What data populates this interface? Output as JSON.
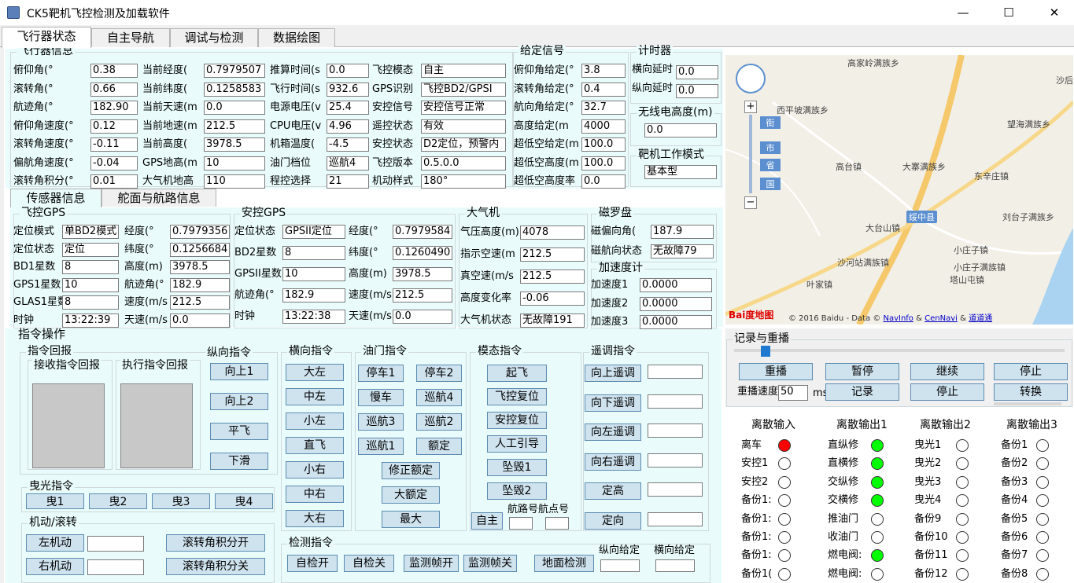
{
  "window": {
    "title": "CK5靶机飞控检测及加载软件",
    "minimize": "—",
    "maximize": "☐",
    "close": "✕"
  },
  "tabs": [
    "飞行器状态",
    "自主导航",
    "调试与检测",
    "数据绘图"
  ],
  "aircraft_info": {
    "title": "飞行器信息",
    "col1": [
      [
        "俯仰角(°",
        "0.38"
      ],
      [
        "滚转角(°",
        "0.66"
      ],
      [
        "航迹角(°",
        "182.90"
      ],
      [
        "俯仰角速度(°",
        "0.12"
      ],
      [
        "滚转角速度(°",
        "-0.11"
      ],
      [
        "偏航角速度(°",
        "-0.04"
      ],
      [
        "滚转角积分(°",
        "0.01"
      ]
    ],
    "col2": [
      [
        "当前经度(",
        "0.7979507"
      ],
      [
        "当前纬度(",
        "0.1258583"
      ],
      [
        "当前天速(m",
        "0.0"
      ],
      [
        "当前地速(m",
        "212.5"
      ],
      [
        "当前高度(",
        "3978.5"
      ],
      [
        "GPS地高(m",
        "10"
      ],
      [
        "大气机地高",
        "110"
      ]
    ],
    "col3": [
      [
        "推算时间(s",
        "0.0"
      ],
      [
        "飞行时间(s",
        "932.6"
      ],
      [
        "电源电压(v",
        "25.4"
      ],
      [
        "CPU电压(v",
        "4.96"
      ],
      [
        "机箱温度(",
        "-4.5"
      ],
      [
        "油门档位",
        "巡航4"
      ],
      [
        "程控选择",
        "21"
      ]
    ],
    "col4": [
      [
        "飞控模态",
        "自主"
      ],
      [
        "GPS识别",
        "飞控BD2/GPSI"
      ],
      [
        "安控信号",
        "安控信号正常"
      ],
      [
        "遥控状态",
        "有效"
      ],
      [
        "安控状态",
        "D2定位，预警内"
      ],
      [
        "飞控版本",
        "0.5.0.0"
      ],
      [
        "机动样式",
        "180°"
      ]
    ]
  },
  "given_signal": {
    "title": "给定信号",
    "rows": [
      [
        "俯仰角给定(°",
        "3.8"
      ],
      [
        "滚转角给定(°",
        "0.4"
      ],
      [
        "航向角给定(°",
        "32.7"
      ],
      [
        "高度给定(m",
        "4000"
      ],
      [
        "超低空给定(m",
        "100.0"
      ],
      [
        "超低空高度(m",
        "100.0"
      ],
      [
        "超低空高度率",
        "0.0"
      ]
    ]
  },
  "timer": {
    "title": "计时器",
    "rows": [
      [
        "横向延时",
        "0.0"
      ],
      [
        "纵向延时",
        "0.0"
      ]
    ]
  },
  "radio_alt": {
    "title": "无线电高度(m)",
    "value": "0.0"
  },
  "work_mode": {
    "title": "靶机工作模式",
    "value": "基本型"
  },
  "map": {
    "labels": [
      "高家岭满族乡",
      "西平坡满族乡",
      "望海满族乡",
      "高台镇",
      "大寨满族乡",
      "东辛庄镇",
      "绥中县",
      "刘台子满族乡",
      "大台山镇",
      "沙河站满族镇",
      "小庄子镇",
      "小庄子满族镇",
      "塔山屯镇",
      "叶家镇",
      "沙后"
    ],
    "zoom_levels": [
      "街",
      "市",
      "省",
      "国"
    ],
    "copyright": "© 2016 Baidu - Data ©",
    "navinfo": "NavInfo",
    "amp": "&",
    "cennavi": "CenNavi",
    "daodaotong": "道道通",
    "logo": "Bai度地图",
    "plus": "+",
    "minus": "−"
  },
  "subtabs": [
    "传感器信息",
    "舵面与航路信息"
  ],
  "fc_gps": {
    "title": "飞控GPS",
    "left": [
      [
        "定位模式",
        "单BD2模式"
      ],
      [
        "定位状态",
        "定位"
      ],
      [
        "BD1星数",
        "8"
      ],
      [
        "GPS1星数",
        "10"
      ],
      [
        "GLAS1星数",
        "8"
      ],
      [
        "时钟",
        "13:22:39"
      ]
    ],
    "right": [
      [
        "经度(°",
        "0.7979356"
      ],
      [
        "纬度(°",
        "0.1256684"
      ],
      [
        "高度(m)",
        "3978.5"
      ],
      [
        "航迹角(°",
        "182.9"
      ],
      [
        "速度(m/s",
        "212.5"
      ],
      [
        "天速(m/s",
        "0.0"
      ]
    ]
  },
  "sc_gps": {
    "title": "安控GPS",
    "left": [
      [
        "定位状态",
        "GPSII定位"
      ],
      [
        "BD2星数",
        "8"
      ],
      [
        "GPSII星数",
        "10"
      ],
      [
        "航迹角(°",
        "182.9"
      ],
      [
        "时钟",
        "13:22:38"
      ]
    ],
    "right": [
      [
        "经度(°",
        "0.7979584"
      ],
      [
        "纬度(°",
        "0.1260490"
      ],
      [
        "高度(m)",
        "3978.5"
      ],
      [
        "速度(m/s",
        "212.5"
      ],
      [
        "天速(m/s",
        "0.0"
      ]
    ]
  },
  "air_data": {
    "title": "大气机",
    "rows": [
      [
        "气压高度(m)",
        "4078"
      ],
      [
        "指示空速(m",
        "212.5"
      ],
      [
        "真空速(m/s",
        "212.5"
      ],
      [
        "高度变化率",
        "-0.06"
      ],
      [
        "大气机状态",
        "无故障191"
      ]
    ]
  },
  "compass": {
    "title": "磁罗盘",
    "rows": [
      [
        "磁偏向角(",
        "187.9"
      ],
      [
        "磁航向状态",
        "无故障79"
      ]
    ]
  },
  "accel": {
    "title": "加速度计",
    "rows": [
      [
        "加速度1",
        "0.0000"
      ],
      [
        "加速度2",
        "0.0000"
      ],
      [
        "加速度3",
        "0.0000"
      ]
    ]
  },
  "cmd": {
    "title": "指令操作",
    "echo": {
      "title": "指令回报",
      "recv": "接收指令回报",
      "exec": "执行指令回报"
    },
    "long": {
      "title": "纵向指令",
      "buttons": [
        "向上1",
        "向上2",
        "平飞",
        "下滑"
      ]
    },
    "lat": {
      "title": "横向指令",
      "buttons": [
        "大左",
        "中左",
        "小左",
        "直飞",
        "小右",
        "中右",
        "大右"
      ]
    },
    "throttle": {
      "title": "油门指令",
      "buttons": [
        "停车1",
        "停车2",
        "慢车",
        "巡航4",
        "巡航3",
        "巡航2",
        "巡航1",
        "额定",
        "修正额定",
        "大额定",
        "最大"
      ]
    },
    "mode": {
      "title": "模态指令",
      "buttons": [
        "起飞",
        "飞控复位",
        "安控复位",
        "人工引导",
        "坠毁1",
        "坠毁2",
        "自主"
      ],
      "route_label": "航路号航点号"
    },
    "remote": {
      "title": "遥调指令",
      "buttons": [
        "向上遥调",
        "向下遥调",
        "向左遥调",
        "向右遥调",
        "定高",
        "定向"
      ]
    },
    "tracer": {
      "title": "曳光指令",
      "buttons": [
        "曳1",
        "曳2",
        "曳3",
        "曳4"
      ]
    },
    "maneuver": {
      "title": "机动/滚转",
      "buttons": [
        "左机动",
        "右机动",
        "滚转角积分开",
        "滚转角积分关"
      ]
    },
    "check": {
      "title": "检测指令",
      "buttons": [
        "自检开",
        "自检关",
        "监测帧开",
        "监测帧关",
        "地面检测"
      ],
      "long_given": "纵向给定",
      "lat_given": "横向给定"
    }
  },
  "replay": {
    "title": "记录与重播",
    "buttons": [
      "重播",
      "暂停",
      "继续",
      "停止",
      "记录",
      "停止",
      "转换"
    ],
    "speed_label": "重播速度",
    "speed": "50",
    "unit": "ms"
  },
  "discrete": {
    "headers": [
      "离散输入",
      "离散输出1",
      "离散输出2",
      "离散输出3"
    ],
    "col1": [
      [
        "离车",
        "red"
      ],
      [
        "安控1",
        "off"
      ],
      [
        "安控2",
        "off"
      ],
      [
        "备份1:",
        "off"
      ],
      [
        "备份1:",
        "off"
      ],
      [
        "备份1:",
        "off"
      ],
      [
        "备份1:",
        "off"
      ],
      [
        "备份1(",
        "off"
      ]
    ],
    "col2": [
      [
        "直纵修",
        "green"
      ],
      [
        "直横修",
        "green"
      ],
      [
        "交纵修",
        "green"
      ],
      [
        "交横修",
        "green"
      ],
      [
        "推油门",
        "off"
      ],
      [
        "收油门",
        "off"
      ],
      [
        "燃电阀:",
        "green"
      ],
      [
        "燃电阀:",
        "off"
      ]
    ],
    "col3": [
      [
        "曳光1",
        "off"
      ],
      [
        "曳光2",
        "off"
      ],
      [
        "曳光3",
        "off"
      ],
      [
        "曳光4",
        "off"
      ],
      [
        "备份9",
        "off"
      ],
      [
        "备份10",
        "off"
      ],
      [
        "备份11",
        "off"
      ],
      [
        "备份12",
        "off"
      ]
    ],
    "col4": [
      [
        "备份1",
        "off"
      ],
      [
        "备份2",
        "off"
      ],
      [
        "备份3",
        "off"
      ],
      [
        "备份4",
        "off"
      ],
      [
        "备份5",
        "off"
      ],
      [
        "备份6",
        "off"
      ],
      [
        "备份7",
        "off"
      ],
      [
        "备份8",
        "off"
      ]
    ]
  }
}
